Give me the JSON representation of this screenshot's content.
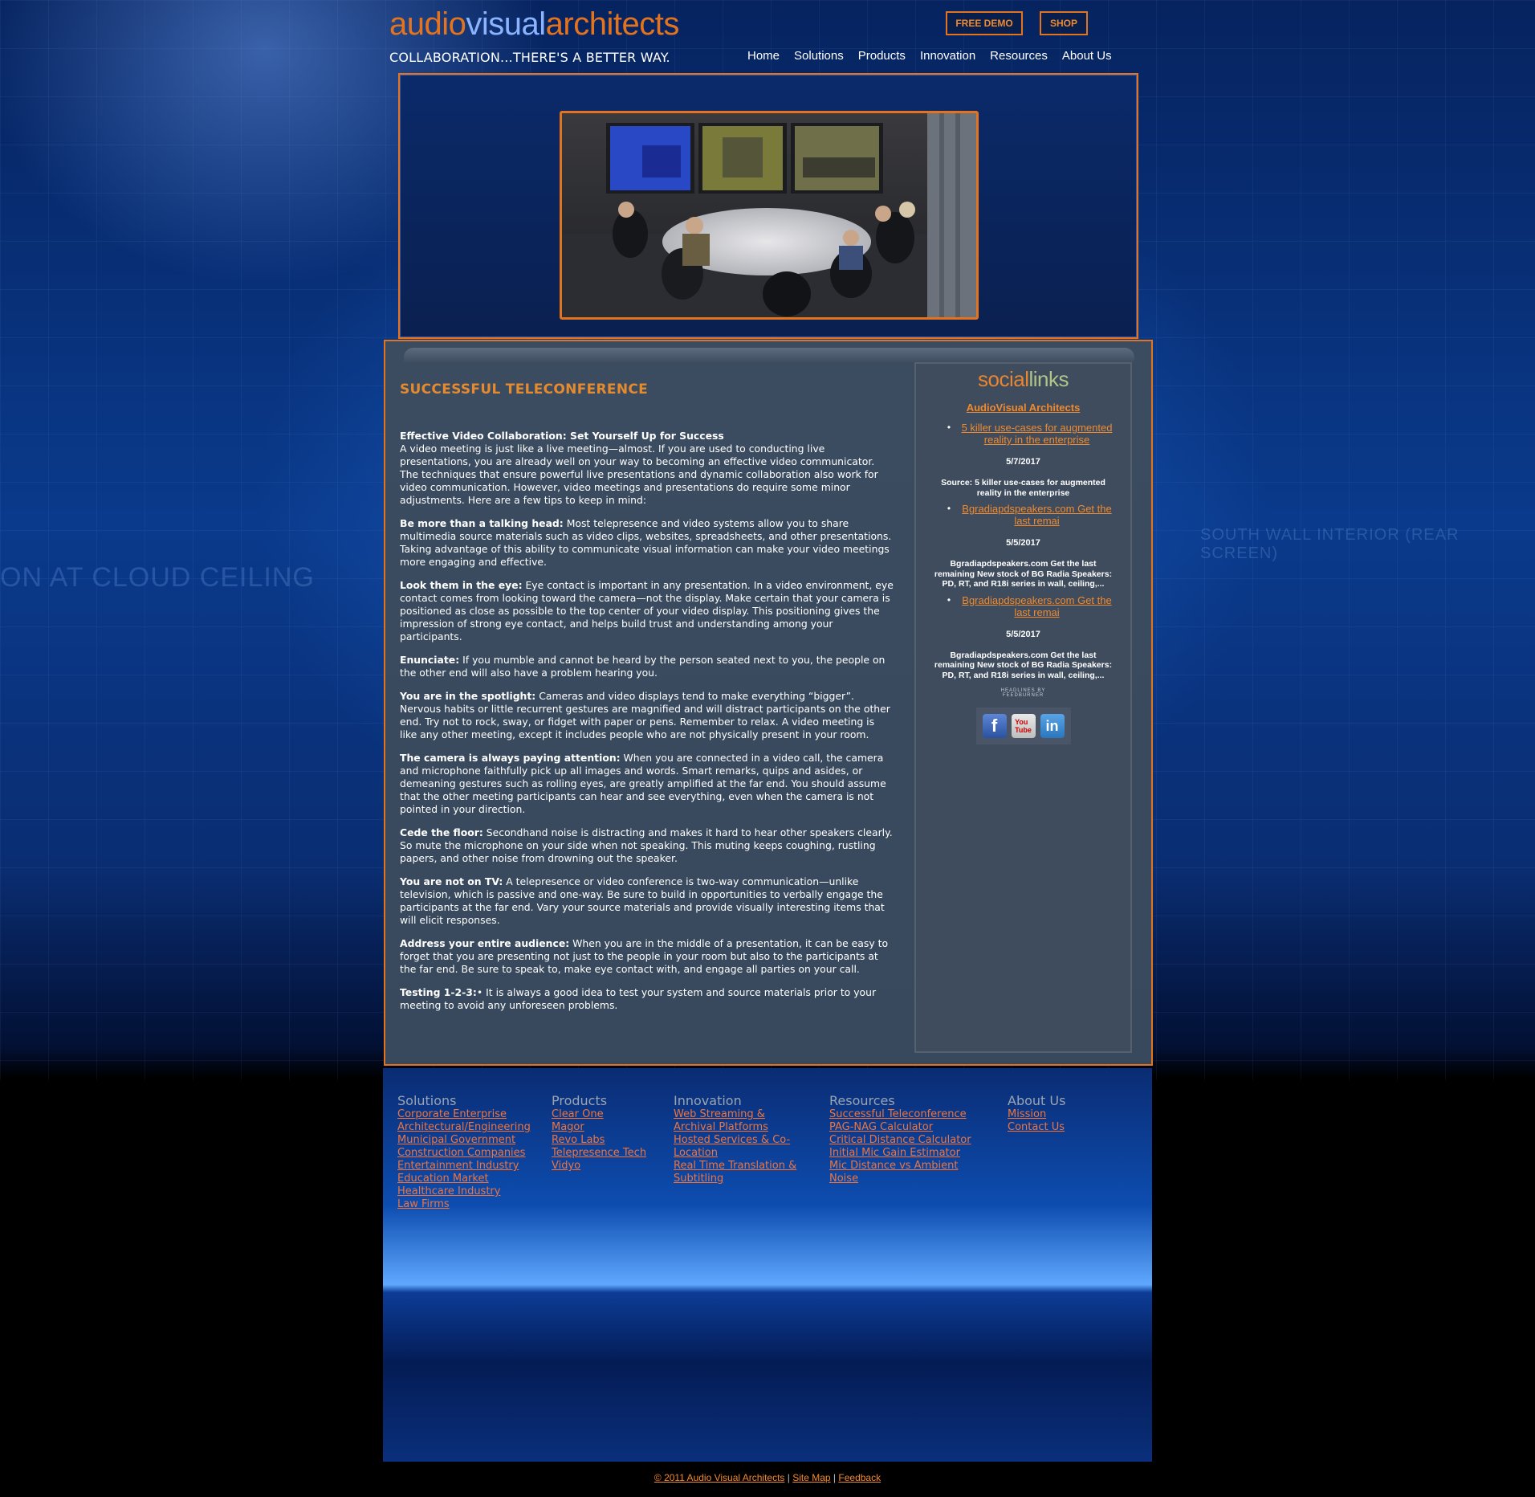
{
  "header": {
    "logo_part1": "audio",
    "logo_part2": "visual",
    "logo_part3": "architects",
    "tagline": "COLLABORATION...THERE'S A BETTER WAY.",
    "free_demo_label": "FREE DEMO",
    "shop_label": "SHOP"
  },
  "nav": {
    "items": [
      "Home",
      "Solutions",
      "Products",
      "Innovation",
      "Resources",
      "About Us"
    ]
  },
  "article": {
    "title": "SUCCESSFUL TELECONFERENCE",
    "lead_title": "Effective Video Collaboration: Set Yourself Up for Success",
    "lead_text": "A video meeting is just like a live meeting—almost. If you are used to conducting live presentations, you are already well on your way to becoming an effective video communicator. The techniques that ensure powerful live presentations and dynamic collaboration also work for video communication. However, video meetings and presentations do require some minor adjustments. Here are a few tips to keep in mind:",
    "tips": [
      {
        "head": "Be more than a talking head:",
        "text": " Most telepresence and video systems allow you to share multimedia source materials such as video clips, websites, spreadsheets, and other presentations. Taking advantage of this ability to communicate visual information can make your video meetings more engaging and effective."
      },
      {
        "head": "Look them in the eye:",
        "text": " Eye contact is important in any presentation. In a video environment, eye contact comes from looking toward the camera—not the display. Make certain that your camera is positioned as close as possible to the top center of your video display. This positioning gives the impression of strong eye contact, and helps build trust and understanding among your participants."
      },
      {
        "head": "Enunciate:",
        "text": " If you mumble and cannot be heard by the person seated next to you, the people on the other end will also have a problem hearing you."
      },
      {
        "head": "You are in the spotlight:",
        "text": " Cameras and video displays tend to make everything “bigger”. Nervous habits or little recurrent gestures are magnified and will distract participants on the other end. Try not to rock, sway, or fidget with paper or pens. Remember to relax. A video meeting is like any other meeting, except it includes people who are not physically present in your room."
      },
      {
        "head": "The camera is always paying attention:",
        "text": "  When you are connected in a video call, the camera and microphone faithfully pick up all images and words. Smart remarks, quips and asides, or demeaning gestures such as rolling eyes, are greatly amplified at the far end. You should assume that the other meeting participants can hear and see everything, even when the camera is not pointed in your direction."
      },
      {
        "head": "Cede the floor:",
        "text": " Secondhand noise is distracting and makes it hard to hear other speakers clearly. So mute the microphone on your side when not speaking. This muting keeps coughing, rustling papers, and other noise from drowning out the speaker."
      },
      {
        "head": "You are not on TV:",
        "text": " A telepresence or video conference is two-way communication—unlike television, which is passive and one-way. Be sure to build in opportunities to verbally engage the participants at the far end. Vary your source materials and provide visually interesting items that will elicit responses."
      },
      {
        "head": "Address your entire audience:",
        "text": " When you are in the middle of a presentation, it can be easy to forget that you are presenting not just to the people in your room but also to the participants at the far end. Be sure to speak to, make eye contact with, and engage all parties on your call."
      },
      {
        "head": "Testing 1-2-3:",
        "text": "• It is always a good idea to test your system and source materials prior to your meeting to avoid any unforeseen problems."
      }
    ]
  },
  "sidebar": {
    "title_part1": "social",
    "title_part2": "links",
    "feed_title": "AudioVisual Architects",
    "feed_items": [
      {
        "link": "5 killer use-cases for augmented reality in the enterprise",
        "date": "5/7/2017",
        "desc": "Source: 5 killer use-cases for augmented reality in the enterprise"
      },
      {
        "link": "Bgradiapdspeakers.com Get the last remai",
        "date": "5/5/2017",
        "desc": "Bgradiapdspeakers.com Get the last remaining New stock of BG Radia Speakers: PD, RT, and R18i series in wall, ceiling,..."
      },
      {
        "link": "Bgradiapdspeakers.com Get the last remai",
        "date": "5/5/2017",
        "desc": "Bgradiapdspeakers.com Get the last remaining New stock of BG Radia Speakers: PD, RT, and R18i series in wall, ceiling,..."
      }
    ],
    "feedburner": "HEADLINES BY FEEDBURNER",
    "icons": [
      "facebook-icon",
      "youtube-icon",
      "linkedin-icon"
    ]
  },
  "footer": {
    "columns": [
      {
        "title": "Solutions",
        "links": [
          "Corporate Enterprise",
          "Architectural/Engineering",
          "Municipal Government",
          "Construction Companies",
          "Entertainment Industry",
          "Education Market",
          "Healthcare Industry",
          "Law Firms"
        ]
      },
      {
        "title": "Products",
        "links": [
          "Clear One",
          "Magor",
          "Revo Labs",
          "Telepresence Tech",
          "Vidyo"
        ]
      },
      {
        "title": "Innovation",
        "links": [
          "Web Streaming & Archival Platforms",
          "Hosted Services & Co-Location",
          "Real Time Translation & Subtitling"
        ]
      },
      {
        "title": "Resources",
        "links": [
          "Successful Teleconference",
          "PAG-NAG Calculator",
          "Critical Distance Calculator",
          "Initial Mic Gain Estimator",
          "Mic Distance vs Ambient Noise"
        ]
      },
      {
        "title": "About Us",
        "links": [
          "Mission",
          "Contact Us"
        ]
      }
    ],
    "copyright": "© 2011 Audio Visual Architects",
    "sitemap": "Site Map",
    "feedback": "Feedback",
    "separator": "|"
  },
  "background": {
    "left_text": "ON AT CLOUD CEILING",
    "right_text": "SOUTH WALL INTERIOR (REAR SCREEN)"
  },
  "colors": {
    "accent": "#e4731e",
    "link": "#f08a2e",
    "panel": "#384a5f"
  }
}
